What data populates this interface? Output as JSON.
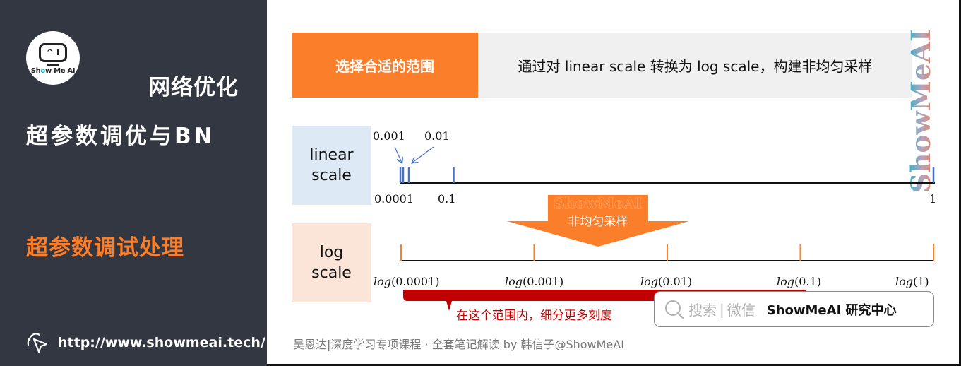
{
  "sidebar": {
    "logo_screen_text": "^ I",
    "logo_text_pre": "Sh",
    "logo_text_o": "o",
    "logo_text_post": "w Me AI",
    "title_line1": "网络优化",
    "title_line2": "超参数调优与BN",
    "subtitle": "超参数调试处理",
    "url": "http://www.showmeai.tech/",
    "icons": {
      "cursor": "cursor-click-icon"
    }
  },
  "banner": {
    "label": "选择合适的范围",
    "description": "通过对 linear scale 转换为 log scale，构建非均匀采样"
  },
  "watermark": "ShowMeAI",
  "linear_scale": {
    "label_line1": "linear",
    "label_line2": "scale",
    "top_labels": [
      "0.001",
      "0.01"
    ],
    "bottom_labels": [
      "0.0001",
      "0.1"
    ],
    "end_label": "1",
    "tick_values": [
      0.0001,
      0.001,
      0.01,
      0.1,
      1
    ]
  },
  "arrow": {
    "brand": "ShowMeAI",
    "text": "非均匀采样"
  },
  "log_scale": {
    "label_line1": "log",
    "label_line2": "scale",
    "tick_labels": [
      {
        "fn": "log",
        "arg": "(0.0001)"
      },
      {
        "fn": "log",
        "arg": "(0.001)"
      },
      {
        "fn": "log",
        "arg": "(0.01)"
      },
      {
        "fn": "log",
        "arg": "(0.1)"
      },
      {
        "fn": "log",
        "arg": "(1)"
      }
    ],
    "bracket_note": "在这个范围内，细分更多刻度"
  },
  "search_box": {
    "text1": "搜索",
    "separator": "|",
    "text2": "微信",
    "brand": "ShowMeAI 研究中心",
    "icon": "search-icon"
  },
  "footer": "吴恩达|深度学习专项课程 · 全套笔记解读  by 韩信子@ShowMeAI",
  "colors": {
    "sidebar_bg": "#323741",
    "accent_orange": "#fb7e2a",
    "linear_tick_blue": "#4472c4",
    "bracket_red": "#c00000",
    "banner_gray": "#f0f0f0",
    "linear_label_bg": "#dde9f5",
    "log_label_bg": "#fbe4d8"
  }
}
